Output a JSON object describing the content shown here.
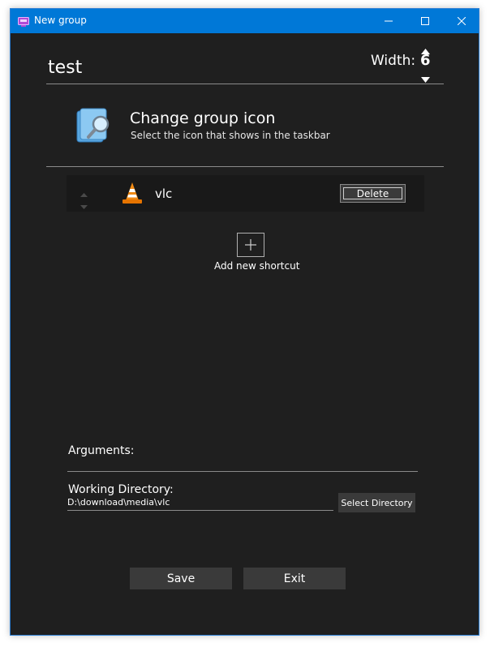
{
  "window": {
    "title": "New group",
    "title_bar_color": "#0078d7",
    "icons": {
      "app": "taskbar-group-icon",
      "minimize": "minimize-icon",
      "maximize": "maximize-icon",
      "close": "close-icon"
    }
  },
  "group": {
    "name": "test",
    "width_label": "Width:",
    "width_value": "6"
  },
  "icon_section": {
    "title": "Change group icon",
    "subtitle": "Select the icon that shows in the taskbar"
  },
  "shortcuts": [
    {
      "name": "vlc",
      "icon": "vlc-cone-icon",
      "delete_label": "Delete"
    }
  ],
  "add_shortcut": {
    "label": "Add new shortcut"
  },
  "arguments": {
    "label": "Arguments:",
    "value": ""
  },
  "working_directory": {
    "label": "Working Directory:",
    "value": "D:\\download\\media\\vlc",
    "button": "Select Directory"
  },
  "footer": {
    "save": "Save",
    "exit": "Exit"
  }
}
